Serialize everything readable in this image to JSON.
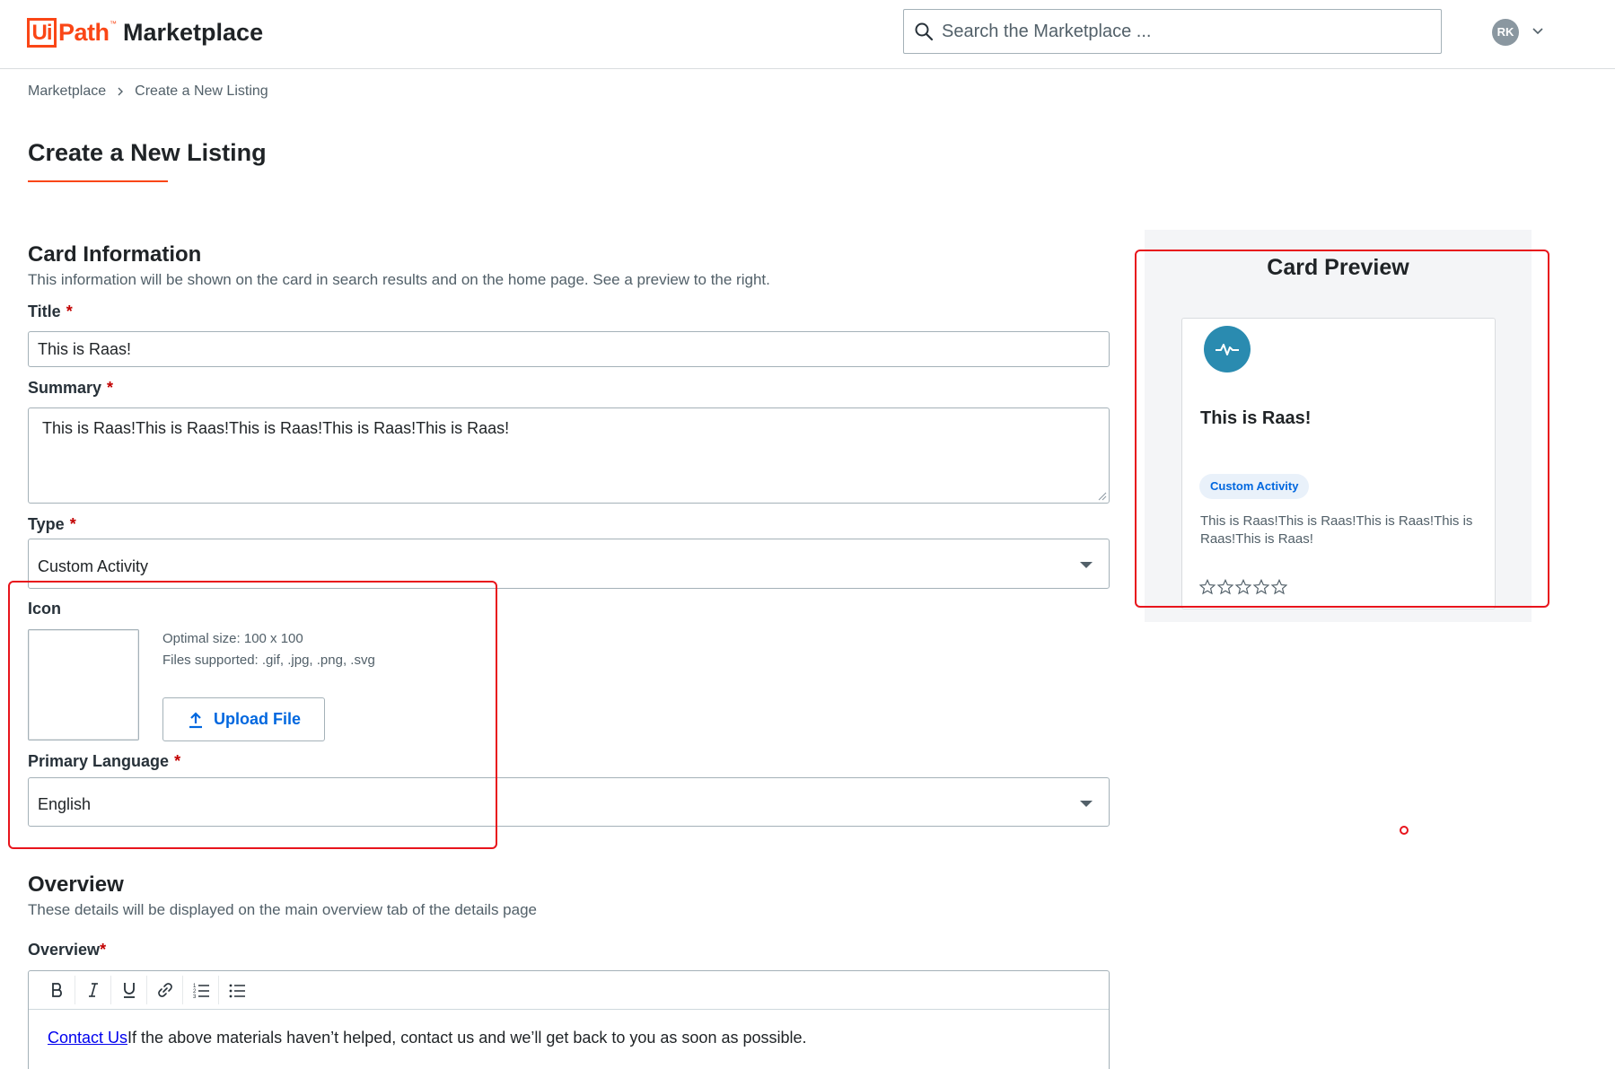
{
  "header": {
    "logo_ui": "Ui",
    "logo_path": "Path",
    "logo_tm": "™",
    "app_name": "Marketplace",
    "search_placeholder": "Search the Marketplace ...",
    "avatar_initials": "RK"
  },
  "breadcrumb": {
    "items": [
      "Marketplace",
      "Create a New Listing"
    ]
  },
  "page_title": "Create a New Listing",
  "card_info": {
    "heading": "Card Information",
    "description": "This information will be shown on the card in search results and on the home page. See a preview to the right.",
    "title_label": "Title",
    "title_value": "This is Raas!",
    "summary_label": "Summary",
    "summary_value": "This is Raas!This is Raas!This is Raas!This is Raas!This is Raas!",
    "type_label": "Type",
    "type_value": "Custom Activity",
    "icon_label": "Icon",
    "icon_hint_size": "Optimal size: 100 x 100",
    "icon_hint_files": "Files supported: .gif, .jpg, .png, .svg",
    "upload_label": "Upload File",
    "language_label": "Primary Language",
    "language_value": "English",
    "required_mark": "*"
  },
  "overview": {
    "heading": "Overview",
    "description": "These details will be displayed on the main overview tab of the details page",
    "field_label": "Overview",
    "toolbar": [
      "bold",
      "italic",
      "underline",
      "link",
      "numbered-list",
      "bullet-list"
    ],
    "content_link": "Contact Us",
    "content_text": "If the above materials haven’t helped, contact us and we’ll get back to you as soon as possible."
  },
  "preview": {
    "heading": "Card Preview",
    "card_title": "This is Raas!",
    "card_badge": "Custom Activity",
    "card_summary": "This is Raas!This is Raas!This is Raas!This is Raas!This is Raas!",
    "rating": 0,
    "rating_max": 5,
    "icon_name": "activity-pulse-icon"
  },
  "colors": {
    "brand": "#fa4616",
    "link": "#0067df",
    "annotation": "#e8141c",
    "card_icon_bg": "#2a8bb0"
  }
}
